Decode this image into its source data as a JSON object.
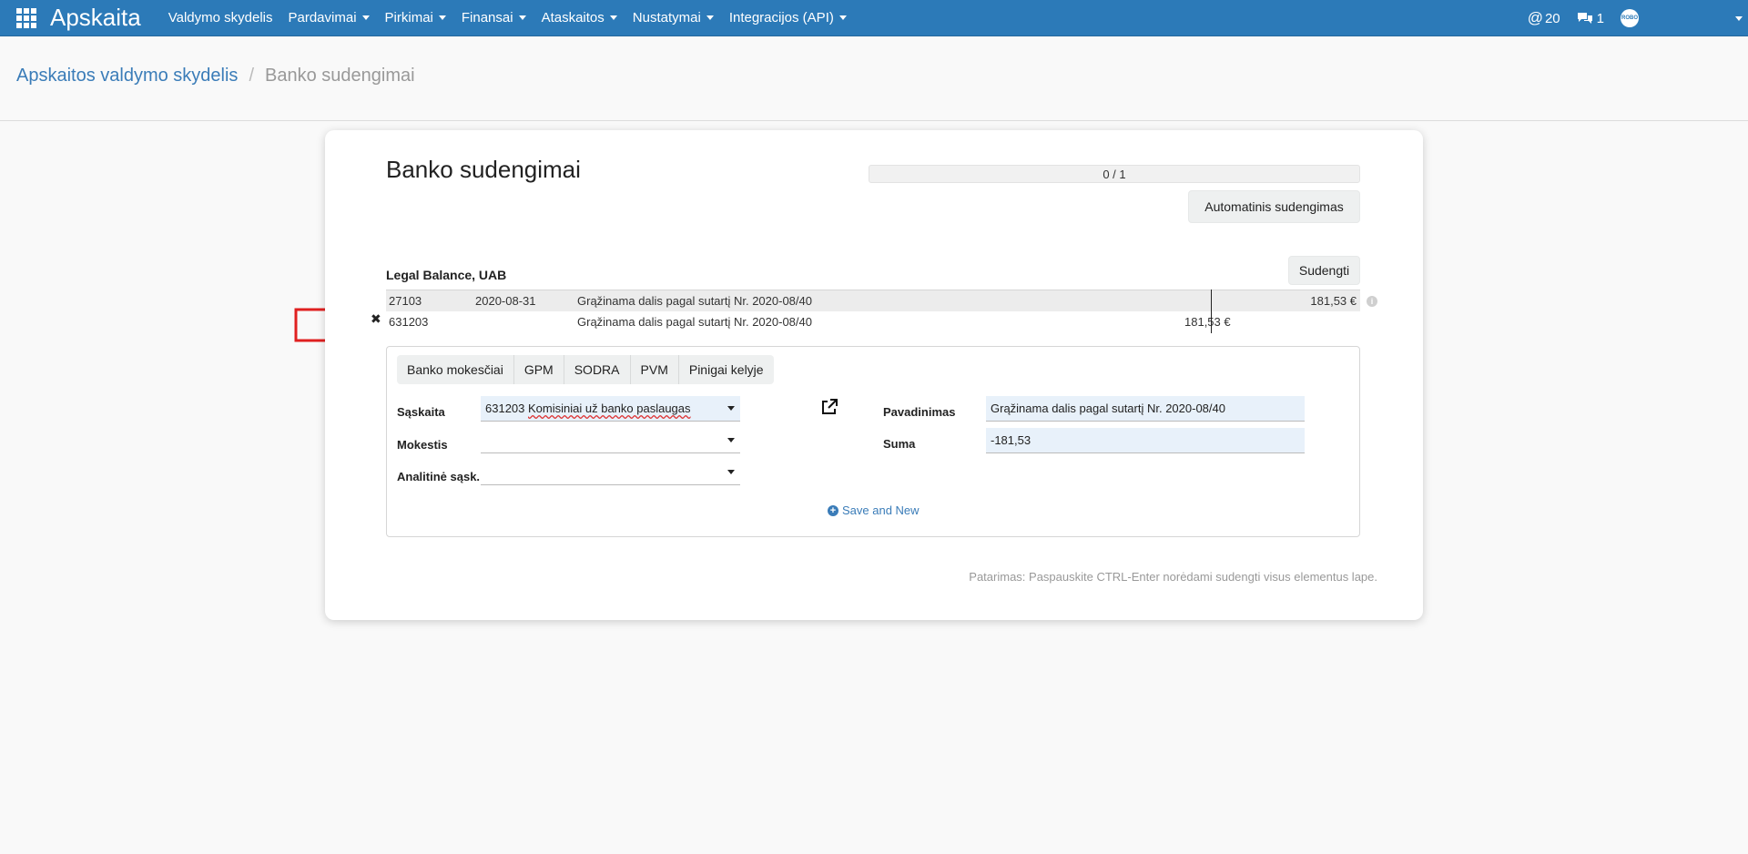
{
  "navbar": {
    "brand": "Apskaita",
    "menu": [
      {
        "label": "Valdymo skydelis",
        "has_caret": false
      },
      {
        "label": "Pardavimai",
        "has_caret": true
      },
      {
        "label": "Pirkimai",
        "has_caret": true
      },
      {
        "label": "Finansai",
        "has_caret": true
      },
      {
        "label": "Ataskaitos",
        "has_caret": true
      },
      {
        "label": "Nustatymai",
        "has_caret": true
      },
      {
        "label": "Integracijos (API)",
        "has_caret": true
      }
    ],
    "mentions_count": "20",
    "messages_count": "1",
    "avatar_text": "ROBO"
  },
  "breadcrumb": {
    "parent": "Apskaitos valdymo skydelis",
    "separator": "/",
    "current": "Banko sudengimai"
  },
  "page": {
    "title": "Banko sudengimai",
    "progress": {
      "text": "0 / 1",
      "fraction": 0
    },
    "auto_button": "Automatinis sudengimas",
    "company": "Legal Balance, UAB",
    "match_button": "Sudengti",
    "hint": "Patarimas: Paspauskite CTRL-Enter norėdami sudengti visus elementus lape."
  },
  "rows": [
    {
      "code": "27103",
      "date": "2020-08-31",
      "desc": "Grąžinama dalis pagal sutartį Nr. 2020-08/40",
      "debit": "",
      "credit": "181,53 €"
    },
    {
      "code": "631203",
      "date": "",
      "desc": "Grąžinama dalis pagal sutartį Nr. 2020-08/40",
      "debit": "181,53 €",
      "credit": ""
    }
  ],
  "form": {
    "tabs": [
      "Banko mokesčiai",
      "GPM",
      "SODRA",
      "PVM",
      "Pinigai kelyje"
    ],
    "account_label": "Sąskaita",
    "account_code": "631203",
    "account_name": "Komisiniai už banko paslaugas",
    "tax_label": "Mokestis",
    "analytic_label": "Analitinė sąsk.",
    "name_label": "Pavadinimas",
    "name_value": "Grąžinama dalis pagal sutartį Nr. 2020-08/40",
    "sum_label": "Suma",
    "sum_value": "-181,53",
    "save_new": "Save and New"
  },
  "colors": {
    "navbar": "#2c7ab8",
    "link": "#3a7cb8",
    "arrow": "#e02020",
    "input_fill": "#e8f1fa"
  }
}
